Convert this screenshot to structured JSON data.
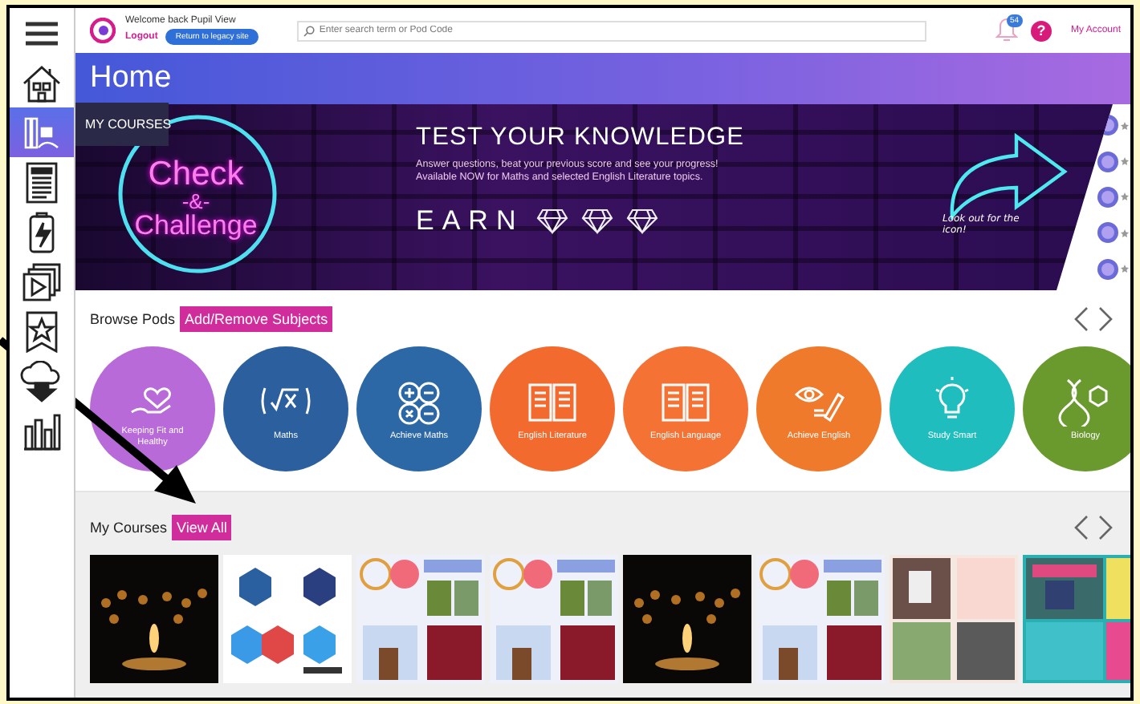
{
  "sidebar": {
    "tooltip": "MY COURSES",
    "items": [
      {
        "kind": "menu",
        "selected": false
      },
      {
        "kind": "home",
        "selected": false
      },
      {
        "kind": "courses",
        "selected": true
      },
      {
        "kind": "document",
        "selected": false
      },
      {
        "kind": "power",
        "selected": false
      },
      {
        "kind": "play",
        "selected": false
      },
      {
        "kind": "star",
        "selected": false
      },
      {
        "kind": "download",
        "selected": false
      },
      {
        "kind": "chart",
        "selected": false
      }
    ]
  },
  "header": {
    "welcome": "Welcome back Pupil View",
    "logout": "Logout",
    "legacy_button": "Return to legacy site",
    "search": {
      "placeholder": "Enter search term or Pod Code"
    },
    "notifications": "54",
    "help": "?",
    "account": "My Account"
  },
  "page_title": "Home",
  "banner": {
    "logo_lines": [
      "Check",
      "-&-",
      "Challenge"
    ],
    "title": "TEST YOUR KNOWLEDGE",
    "text": "Answer questions, beat your previous score and see your progress! Available NOW for Maths and selected English Literature topics.",
    "earn": "EARN",
    "hint": "Look out for the icon!"
  },
  "pods": {
    "title": "Browse Pods",
    "button": "Add/Remove Subjects",
    "items": [
      {
        "label": "Keeping Fit and Healthy",
        "color": "#b86ad8",
        "kind": "heart"
      },
      {
        "label": "Maths",
        "color": "#2b5f9e",
        "kind": "root"
      },
      {
        "label": "Achieve Maths",
        "color": "#2c68a6",
        "kind": "operators"
      },
      {
        "label": "English Literature",
        "color": "#f26a2e",
        "kind": "book"
      },
      {
        "label": "English Language",
        "color": "#f47334",
        "kind": "book"
      },
      {
        "label": "Achieve English",
        "color": "#f07a2c",
        "kind": "eye"
      },
      {
        "label": "Study Smart",
        "color": "#1fbdbd",
        "kind": "bulb"
      },
      {
        "label": "Biology",
        "color": "#6a9a2e",
        "kind": "dna"
      }
    ]
  },
  "courses": {
    "title": "My Courses",
    "button": "View All"
  }
}
